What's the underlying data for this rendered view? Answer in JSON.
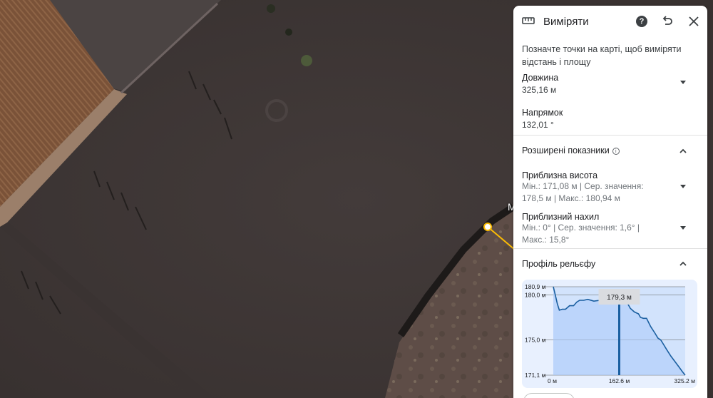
{
  "panel": {
    "title": "Виміряти",
    "help_icon": "question-mark-icon",
    "hint": "Позначте точки на карті, щоб виміряти відстань і площу",
    "length": {
      "label": "Довжина",
      "value": "325,16 м"
    },
    "direction": {
      "label": "Напрямок",
      "value": "132,01 °"
    },
    "advanced": {
      "title": "Розширені показники",
      "elevation": {
        "label": "Приблизна висота",
        "value": "Мін.: 171,08 м | Сер. значення: 178,5 м | Макс.: 180,94 м"
      },
      "slope": {
        "label": "Приблизний нахил",
        "value": "Мін.: 0° | Сер. значення: 1,6° | Макс.: 15,8°"
      }
    },
    "profile": {
      "title": "Профіль рельєфу"
    }
  },
  "map": {
    "partial_label": "M"
  },
  "chart_data": {
    "type": "area",
    "y_tick_labels": [
      "180,9 м",
      "180,0 м",
      "175,0 м",
      "171,1 м"
    ],
    "y_ticks": [
      180.9,
      180.0,
      175.0,
      171.1
    ],
    "x_tick_labels": [
      "0 м",
      "162.6 м",
      "325.2 м"
    ],
    "x_ticks": [
      0,
      162.6,
      325.2
    ],
    "ylim": [
      171.1,
      180.9
    ],
    "xlim": [
      0,
      325.2
    ],
    "cursor": {
      "x": 162.6,
      "label": "179,3 м"
    },
    "series": [
      {
        "x": [
          0,
          5,
          10,
          15,
          22,
          30,
          40,
          50,
          58,
          65,
          75,
          85,
          100,
          115,
          130,
          145,
          160,
          170,
          180,
          190,
          200,
          210,
          215,
          222,
          230,
          240,
          250,
          258,
          265,
          272,
          280,
          290,
          300,
          310,
          318,
          325.2
        ],
        "values": [
          180.9,
          180.0,
          179.0,
          178.3,
          178.4,
          178.4,
          178.8,
          178.8,
          179.2,
          179.4,
          179.4,
          179.5,
          179.3,
          179.4,
          179.4,
          179.4,
          179.3,
          179.3,
          179.3,
          178.5,
          178.1,
          177.9,
          177.5,
          177.4,
          177.4,
          176.5,
          175.8,
          175.2,
          175.0,
          174.5,
          173.9,
          173.2,
          172.6,
          172.0,
          171.5,
          171.1
        ]
      }
    ]
  }
}
